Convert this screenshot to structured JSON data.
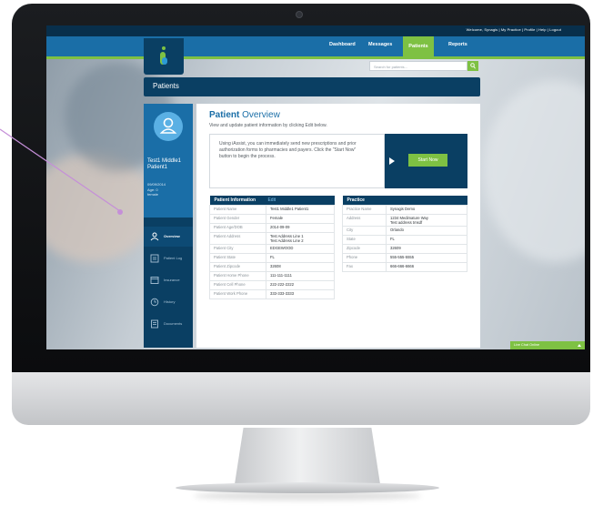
{
  "topbar": {
    "links_text": "Welcome, Synagis | My Practice | Profile | Help | Logout"
  },
  "nav": {
    "dashboard": "Dashboard",
    "messages": "Messages",
    "patients": "Patients",
    "reports": "Reports"
  },
  "search": {
    "placeholder": "Search for patients..."
  },
  "page": {
    "title": "Patients"
  },
  "patient": {
    "name": "Test1 Middle1 Patient1",
    "dob": "09/09/2014",
    "age": "Age: 0",
    "gender": "female"
  },
  "sidebar": {
    "items": [
      {
        "label": "Overview",
        "icon": "user-icon"
      },
      {
        "label": "Patient Log",
        "icon": "log-icon"
      },
      {
        "label": "Insurance",
        "icon": "insurance-icon"
      },
      {
        "label": "History",
        "icon": "history-icon"
      },
      {
        "label": "Documents",
        "icon": "documents-icon"
      }
    ]
  },
  "overview": {
    "title_bold": "Patient",
    "title_rest": "Overview",
    "subtitle": "View and update patient information by clicking Edit below.",
    "callout_text": "Using iAssist, you can immediately send new prescriptions and prior authorization forms to pharmacies and payers. Click the \"Start Now\" button to begin the process.",
    "start_button": "Start Now"
  },
  "patient_table": {
    "header": "Patient Information",
    "edit_label": "Edit",
    "rows": [
      {
        "label": "Patient Name",
        "value": "Test1 Middle1 Patient1"
      },
      {
        "label": "Patient Gender",
        "value": "Female"
      },
      {
        "label": "Patient Age/DOB",
        "value": "2014-09-09"
      },
      {
        "label": "Patient Address",
        "value": "Test Address Line 1",
        "value2": "Test Address Line 2"
      },
      {
        "label": "Patient City",
        "value": "EDGEWOOD"
      },
      {
        "label": "Patient State",
        "value": "FL"
      },
      {
        "label": "Patient Zipcode",
        "value": "32608"
      },
      {
        "label": "Patient Home Phone",
        "value": "111-111-1111"
      },
      {
        "label": "Patient Cell Phone",
        "value": "222-222-2222"
      },
      {
        "label": "Patient Work Phone",
        "value": "333-333-3333"
      }
    ]
  },
  "practice_table": {
    "header": "Practice",
    "rows": [
      {
        "label": "Practice Name",
        "value": "Synagis Demo"
      },
      {
        "label": "Address",
        "value": "1234 Medimature Way",
        "value2": "Test address tmsdf"
      },
      {
        "label": "City",
        "value": "Orlando"
      },
      {
        "label": "State",
        "value": "FL"
      },
      {
        "label": "Zipcode",
        "value": "32609"
      },
      {
        "label": "Phone",
        "value": "555-555-5555"
      },
      {
        "label": "Fax",
        "value": "666-666-6666"
      }
    ]
  },
  "chat": {
    "label": "Live Chat Online"
  },
  "colors": {
    "navy": "#0a3f63",
    "blue": "#1a6ea7",
    "green": "#7ec143",
    "pointer": "#c58fd8"
  }
}
